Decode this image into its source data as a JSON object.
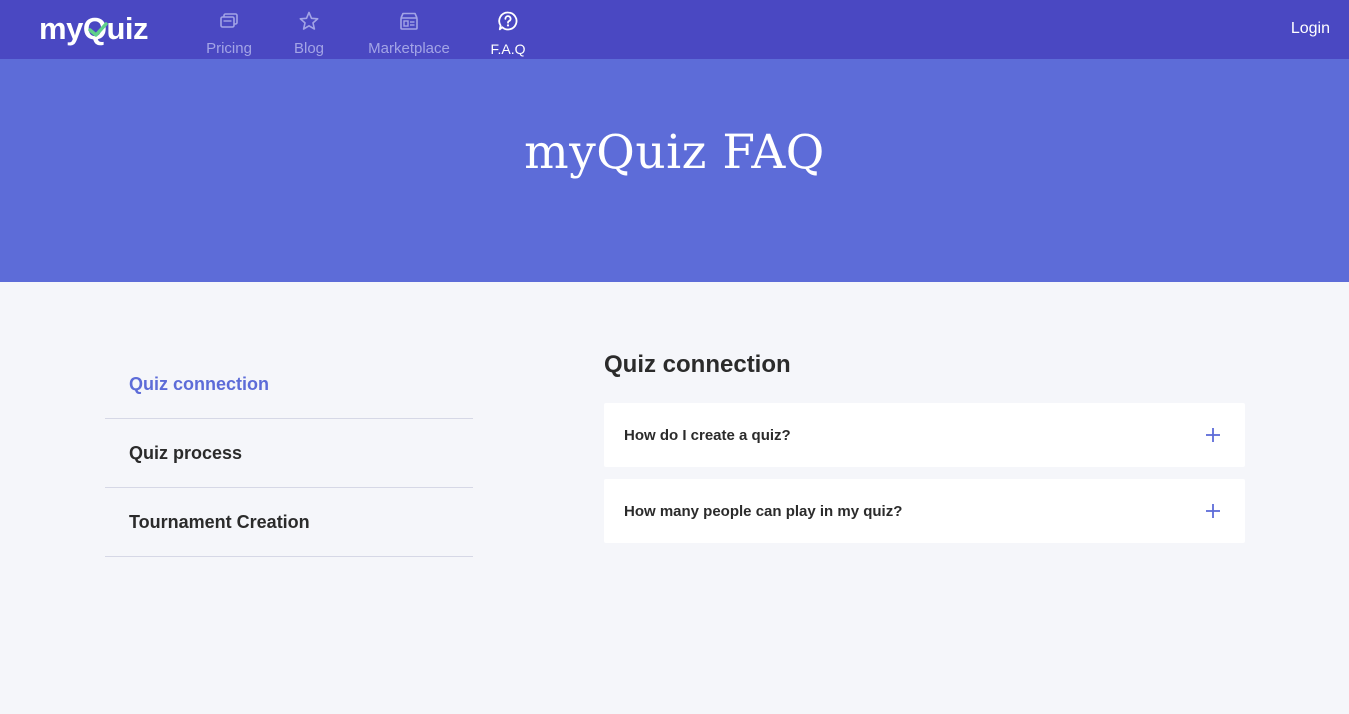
{
  "navbar": {
    "logo_text_left": "my",
    "logo_text_q": "Q",
    "logo_text_right": "uiz",
    "items": [
      {
        "label": "Pricing",
        "icon": "cards-icon"
      },
      {
        "label": "Blog",
        "icon": "star-icon"
      },
      {
        "label": "Marketplace",
        "icon": "store-icon"
      },
      {
        "label": "F.A.Q",
        "icon": "help-bubble-icon",
        "active": true
      }
    ],
    "login_label": "Login"
  },
  "hero": {
    "title": "myQuiz FAQ"
  },
  "sidebar": {
    "items": [
      {
        "label": "Quiz connection",
        "active": true
      },
      {
        "label": "Quiz process"
      },
      {
        "label": "Tournament Creation"
      }
    ]
  },
  "main": {
    "section_title": "Quiz connection",
    "questions": [
      {
        "label": "How do I create a quiz?",
        "icon": "plus-icon"
      },
      {
        "label": "How many people can play in my quiz?",
        "icon": "plus-icon"
      }
    ]
  },
  "colors": {
    "navbar_bg": "#4a48c2",
    "hero_bg": "#5d6cd8",
    "accent": "#5d6cd8",
    "logo_check": "#5fd18a",
    "page_bg": "#f5f6fa"
  }
}
